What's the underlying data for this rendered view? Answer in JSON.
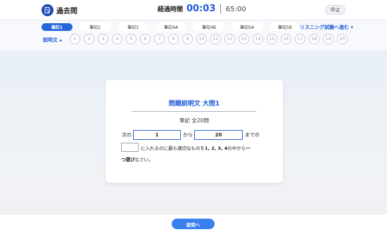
{
  "header": {
    "app_title": "過去問",
    "timer_label": "経過時間",
    "elapsed": "00:03",
    "separator": "|",
    "limit": "65:00",
    "stop_label": "中止"
  },
  "nav": {
    "tabs": [
      {
        "label": "筆記1",
        "active": true
      },
      {
        "label": "筆記2",
        "active": false
      },
      {
        "label": "筆記3",
        "active": false
      },
      {
        "label": "筆記4A",
        "active": false
      },
      {
        "label": "筆記4B",
        "active": false
      },
      {
        "label": "筆記5A",
        "active": false
      },
      {
        "label": "筆記5B",
        "active": false
      }
    ],
    "listening_link": "リスニング試験へ進む ▾",
    "description_toggle": "説明文 ▴",
    "question_numbers": [
      "1",
      "2",
      "3",
      "4",
      "5",
      "6",
      "7",
      "8",
      "9",
      "10",
      "11",
      "12",
      "13",
      "14",
      "15",
      "16",
      "17",
      "18",
      "19",
      "20"
    ]
  },
  "card": {
    "title": "問題説明文 大問1",
    "subtitle": "筆記 全20問",
    "prefix": "次の",
    "from_value": "1",
    "from_suffix": "から",
    "to_value": "20",
    "to_suffix": "までの",
    "instruction_part1": "に入れるのに最も適切なものを",
    "instruction_options": "1, 2, 3, 4",
    "instruction_part2": "の中から",
    "instruction_bold_end": "一",
    "line3_bold": "つ選び",
    "line3_rest": "なさい。"
  },
  "footer": {
    "next_label": "設問へ"
  },
  "colors": {
    "accent": "#1f5bd6",
    "tab_active": "#2767dd",
    "button": "#3a7ff0"
  }
}
